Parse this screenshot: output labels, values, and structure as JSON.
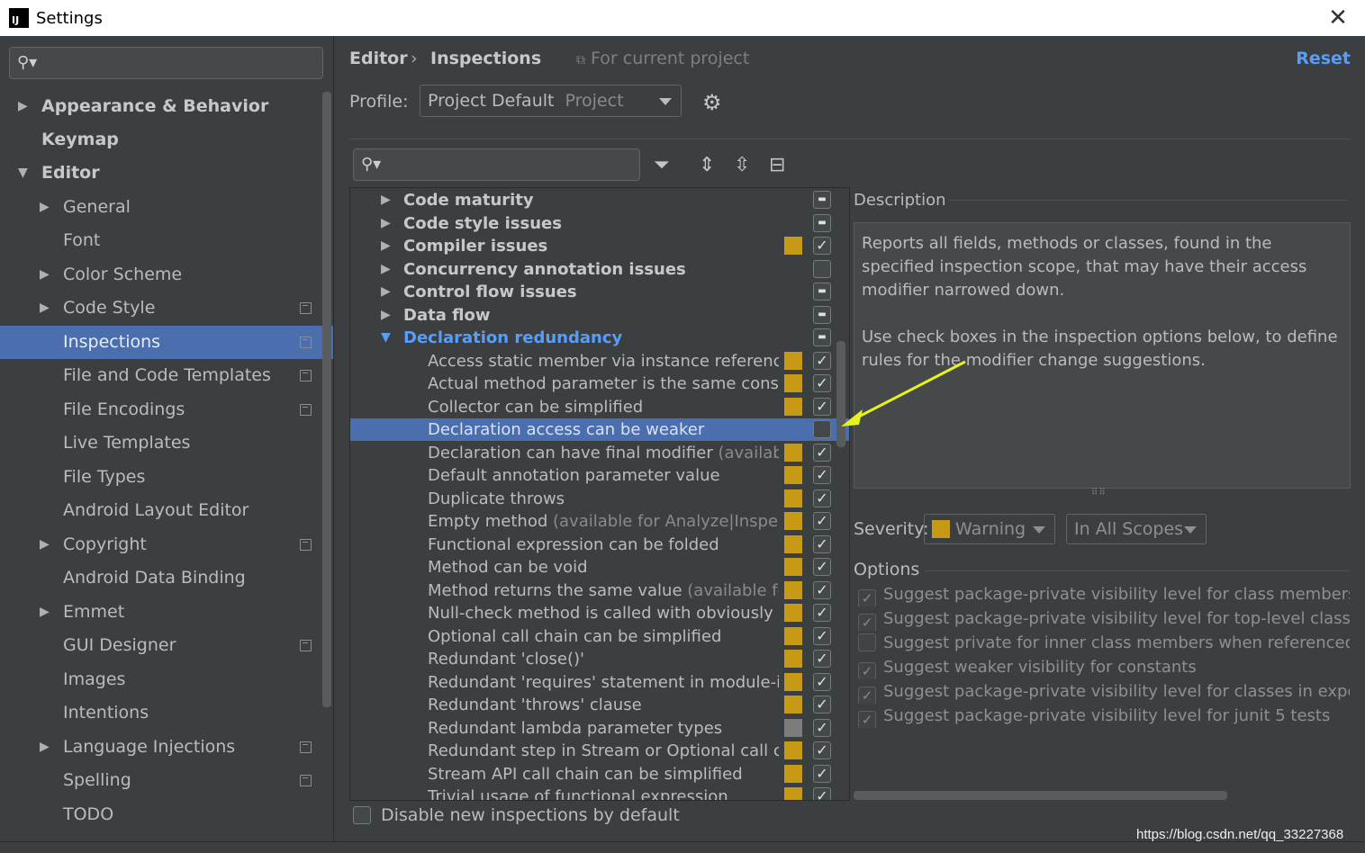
{
  "window": {
    "title": "Settings",
    "app_icon": "intellij-icon",
    "close": "✕"
  },
  "sidebar": {
    "search_placeholder": "",
    "items": [
      {
        "label": "Appearance & Behavior",
        "bold": true,
        "arrow": "right"
      },
      {
        "label": "Keymap",
        "bold": true
      },
      {
        "label": "Editor",
        "bold": true,
        "arrow": "down"
      },
      {
        "label": "General",
        "arrow": "right"
      },
      {
        "label": "Font"
      },
      {
        "label": "Color Scheme",
        "arrow": "right"
      },
      {
        "label": "Code Style",
        "arrow": "right",
        "project": true
      },
      {
        "label": "Inspections",
        "selected": true,
        "project": true
      },
      {
        "label": "File and Code Templates",
        "project": true
      },
      {
        "label": "File Encodings",
        "project": true
      },
      {
        "label": "Live Templates"
      },
      {
        "label": "File Types"
      },
      {
        "label": "Android Layout Editor"
      },
      {
        "label": "Copyright",
        "arrow": "right",
        "project": true
      },
      {
        "label": "Android Data Binding"
      },
      {
        "label": "Emmet",
        "arrow": "right"
      },
      {
        "label": "GUI Designer",
        "project": true
      },
      {
        "label": "Images"
      },
      {
        "label": "Intentions"
      },
      {
        "label": "Language Injections",
        "arrow": "right",
        "project": true
      },
      {
        "label": "Spelling",
        "project": true
      },
      {
        "label": "TODO"
      }
    ]
  },
  "header": {
    "crumb_editor": "Editor",
    "crumb_sep": "›",
    "crumb_inspections": "Inspections",
    "scope_note": "For current project",
    "reset": "Reset"
  },
  "profile": {
    "label": "Profile:",
    "value": "Project Default",
    "suffix": "Project"
  },
  "inspection_search_placeholder": "",
  "inspections": [
    {
      "label": "Code maturity",
      "group": true,
      "state": "minus"
    },
    {
      "label": "Code style issues",
      "group": true,
      "state": "minus"
    },
    {
      "label": "Compiler issues",
      "group": true,
      "state": "check",
      "sev": "#c79a16"
    },
    {
      "label": "Concurrency annotation issues",
      "group": true,
      "state": "empty"
    },
    {
      "label": "Control flow issues",
      "group": true,
      "state": "minus"
    },
    {
      "label": "Data flow",
      "group": true,
      "state": "minus"
    },
    {
      "label": "Declaration redundancy",
      "group": true,
      "expanded": true,
      "state": "minus"
    },
    {
      "label": "Access static member via instance reference",
      "state": "check",
      "sev": "#c79a16"
    },
    {
      "label": "Actual method parameter is the same constar",
      "state": "check",
      "sev": "#c79a16"
    },
    {
      "label": "Collector can be simplified",
      "state": "check",
      "sev": "#c79a16"
    },
    {
      "label": "Declaration access can be weaker",
      "state": "empty",
      "selected": true
    },
    {
      "label": "Declaration can have final modifier",
      "extra": " (available",
      "state": "check",
      "sev": "#c79a16"
    },
    {
      "label": "Default annotation parameter value",
      "state": "check",
      "sev": "#c79a16"
    },
    {
      "label": "Duplicate throws",
      "state": "check",
      "sev": "#c79a16"
    },
    {
      "label": "Empty method",
      "extra": " (available for Analyze|Inspect",
      "state": "check",
      "sev": "#c79a16"
    },
    {
      "label": "Functional expression can be folded",
      "state": "check",
      "sev": "#c79a16"
    },
    {
      "label": "Method can be void",
      "state": "check",
      "sev": "#c79a16"
    },
    {
      "label": "Method returns the same value",
      "extra": " (available for ",
      "state": "check",
      "sev": "#c79a16"
    },
    {
      "label": "Null-check method is called with obviously nc",
      "state": "check",
      "sev": "#c79a16"
    },
    {
      "label": "Optional call chain can be simplified",
      "state": "check",
      "sev": "#c79a16"
    },
    {
      "label": "Redundant 'close()'",
      "state": "check",
      "sev": "#c79a16"
    },
    {
      "label": "Redundant 'requires' statement in module-in",
      "state": "check",
      "sev": "#c79a16"
    },
    {
      "label": "Redundant 'throws' clause",
      "state": "check",
      "sev": "#c79a16"
    },
    {
      "label": "Redundant lambda parameter types",
      "state": "check",
      "sev": "#7c7c7c"
    },
    {
      "label": "Redundant step in Stream or Optional call cha",
      "state": "check",
      "sev": "#c79a16"
    },
    {
      "label": "Stream API call chain can be simplified",
      "state": "check",
      "sev": "#c79a16"
    },
    {
      "label": "Trivial usage of functional expression",
      "state": "check",
      "sev": "#c79a16"
    }
  ],
  "disable_new": "Disable new inspections by default",
  "description": {
    "title": "Description",
    "p1": "Reports all fields, methods or classes, found in the specified inspection scope, that may have their access modifier narrowed down.",
    "p2": "Use check boxes in the inspection options below, to define rules for the modifier change suggestions."
  },
  "severity": {
    "label": "Severity:",
    "value": "Warning",
    "scope": "In All Scopes",
    "color": "#c79a16"
  },
  "options": {
    "title": "Options",
    "items": [
      {
        "label": "Suggest package-private visibility level for class members",
        "checked": true
      },
      {
        "label": "Suggest package-private visibility level for top-level classes",
        "checked": true
      },
      {
        "label": "Suggest private for inner class members when referenced fro",
        "checked": false
      },
      {
        "label": "Suggest weaker visibility for constants",
        "checked": true
      },
      {
        "label": "Suggest package-private visibility level for classes in exporte",
        "checked": true
      },
      {
        "label": "Suggest package-private visibility level for junit 5 tests",
        "checked": true
      }
    ]
  },
  "watermark": "https://blog.csdn.net/qq_33227368",
  "colors": {
    "accent": "#4b6eaf",
    "link": "#589df6",
    "warning": "#c79a16",
    "annotation_arrow": "#e6f21c"
  }
}
